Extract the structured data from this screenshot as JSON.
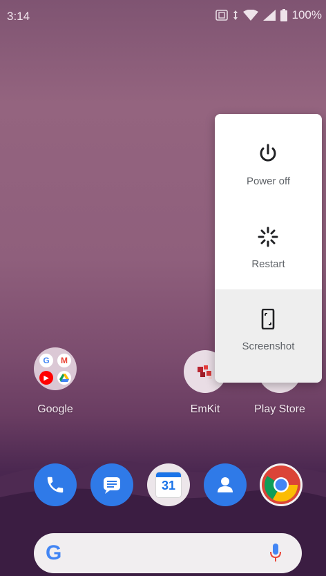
{
  "status_bar": {
    "time": "3:14",
    "battery": "100%",
    "icons": [
      "screenshot-notification-icon",
      "data-arrows-icon",
      "wifi-icon",
      "signal-icon",
      "battery-icon"
    ]
  },
  "home_screen": {
    "apps": [
      {
        "label": "Google",
        "icon": "google-folder-icon"
      },
      {
        "label": "EmKit",
        "icon": "emkit-icon"
      },
      {
        "label": "Play Store",
        "icon": "play-store-icon"
      }
    ],
    "folder_apps": [
      "google-icon",
      "gmail-icon",
      "youtube-icon",
      "drive-icon"
    ],
    "dock": [
      "phone-icon",
      "messages-icon",
      "calendar-icon",
      "contacts-icon",
      "chrome-icon"
    ],
    "calendar_day": "31",
    "search_bar": {
      "logo": "google-g-icon",
      "mic": "mic-icon"
    }
  },
  "power_menu": {
    "items": [
      {
        "label": "Power off",
        "icon": "power-icon"
      },
      {
        "label": "Restart",
        "icon": "restart-icon"
      },
      {
        "label": "Screenshot",
        "icon": "screenshot-icon"
      }
    ]
  },
  "colors": {
    "accent_blue": "#1a73e8",
    "menu_text": "#5f6368",
    "menu_bg": "#ffffff"
  }
}
